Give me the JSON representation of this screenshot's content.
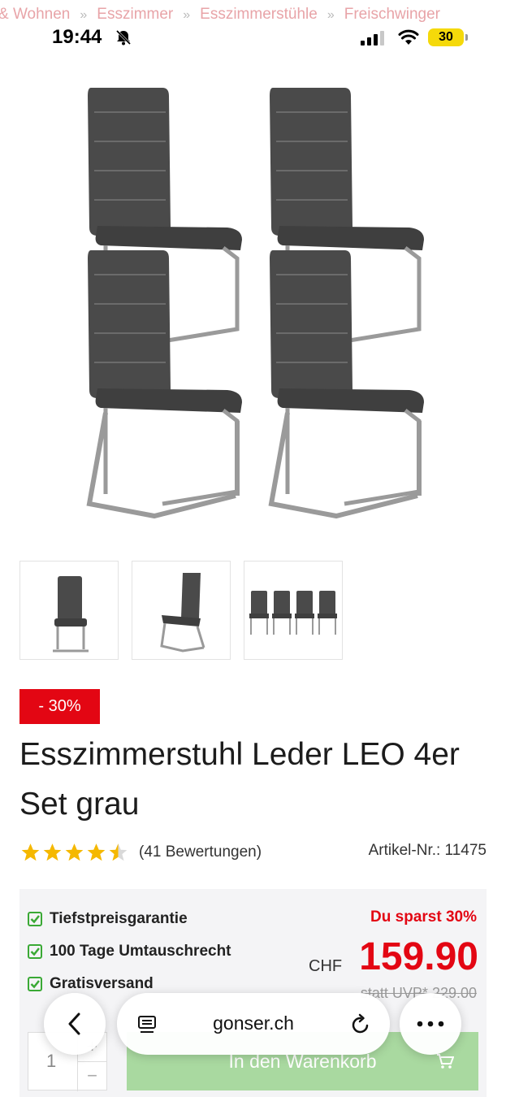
{
  "breadcrumb": {
    "items": [
      "& Wohnen",
      "Esszimmer",
      "Esszimmerstühle",
      "Freischwinger"
    ],
    "separator": "»"
  },
  "status": {
    "time": "19:44",
    "battery": "30",
    "icons": [
      "bell-slash-icon",
      "signal-icon",
      "wifi-icon",
      "battery-icon"
    ]
  },
  "product": {
    "discount_badge": "- 30%",
    "title": "Esszimmerstuhl Leder LEO 4er Set grau",
    "rating_stars": 4.5,
    "reviews": "(41 Bewertungen)",
    "article_number": "Artikel-Nr.: 11475",
    "thumbnails": [
      "chair-front",
      "chair-side",
      "chairs-set-of-four"
    ]
  },
  "pricebox": {
    "usps": [
      "Tiefstpreisgarantie",
      "100 Tage Umtauschrecht",
      "Gratisversand"
    ],
    "savings": "Du sparst 30%",
    "currency": "CHF",
    "price": "159.90",
    "old_price": "statt UVP* 229.00",
    "quantity": "1",
    "cart_button": "In den Warenkorb"
  },
  "browser": {
    "url": "gonser.ch"
  },
  "colors": {
    "accent_red": "#e30613",
    "check_green": "#3aa935",
    "star_yellow": "#f5b800",
    "cart_green": "#a9d9a0"
  }
}
